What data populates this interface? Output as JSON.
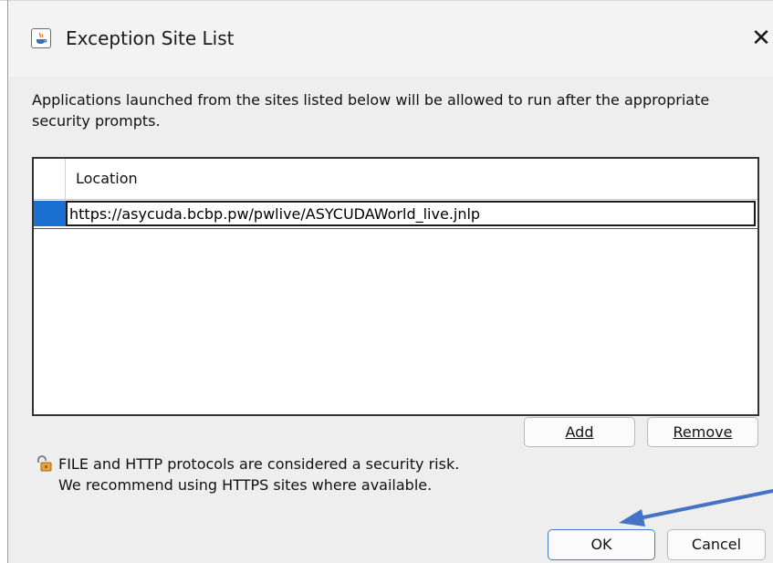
{
  "window": {
    "title": "Exception Site List",
    "icon": "java-app-icon",
    "close_glyph": "✕"
  },
  "description": "Applications launched from the sites listed below will be allowed to run after the appropriate security prompts.",
  "table": {
    "column_header": "Location",
    "rows": [
      {
        "location": "https://asycuda.bcbp.pw/pwlive/ASYCUDAWorld_live.jnlp",
        "selected": true
      }
    ]
  },
  "table_buttons": {
    "add_label": "Add",
    "remove_label": "Remove"
  },
  "warning": {
    "icon": "unlocked-padlock-icon",
    "line1": "FILE and HTTP protocols are considered a security risk.",
    "line2": "We recommend using HTTPS sites where available."
  },
  "dialog_buttons": {
    "ok_label": "OK",
    "cancel_label": "Cancel"
  },
  "annotation": {
    "arrow_color": "#4472c4",
    "points_to": "ok-button"
  },
  "colors": {
    "selection": "#1b6fd1",
    "dialog_background": "#eeeeee",
    "titlebar_background": "#f3f3f3"
  }
}
